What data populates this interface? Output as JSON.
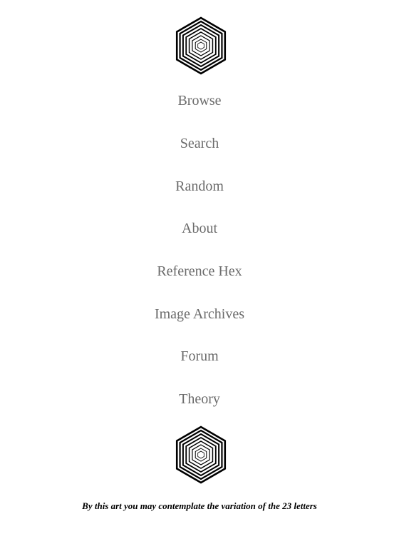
{
  "logo": {
    "icon": "hexagon-nested-icon",
    "color": "#000000"
  },
  "nav": {
    "items": [
      {
        "label": "Browse"
      },
      {
        "label": "Search"
      },
      {
        "label": "Random"
      },
      {
        "label": "About"
      },
      {
        "label": "Reference Hex"
      },
      {
        "label": "Image Archives"
      },
      {
        "label": "Forum"
      },
      {
        "label": "Theory"
      }
    ],
    "color": "#6b6b6b"
  },
  "footer": {
    "motto": "By this art you may contemplate the variation of the 23 letters"
  }
}
